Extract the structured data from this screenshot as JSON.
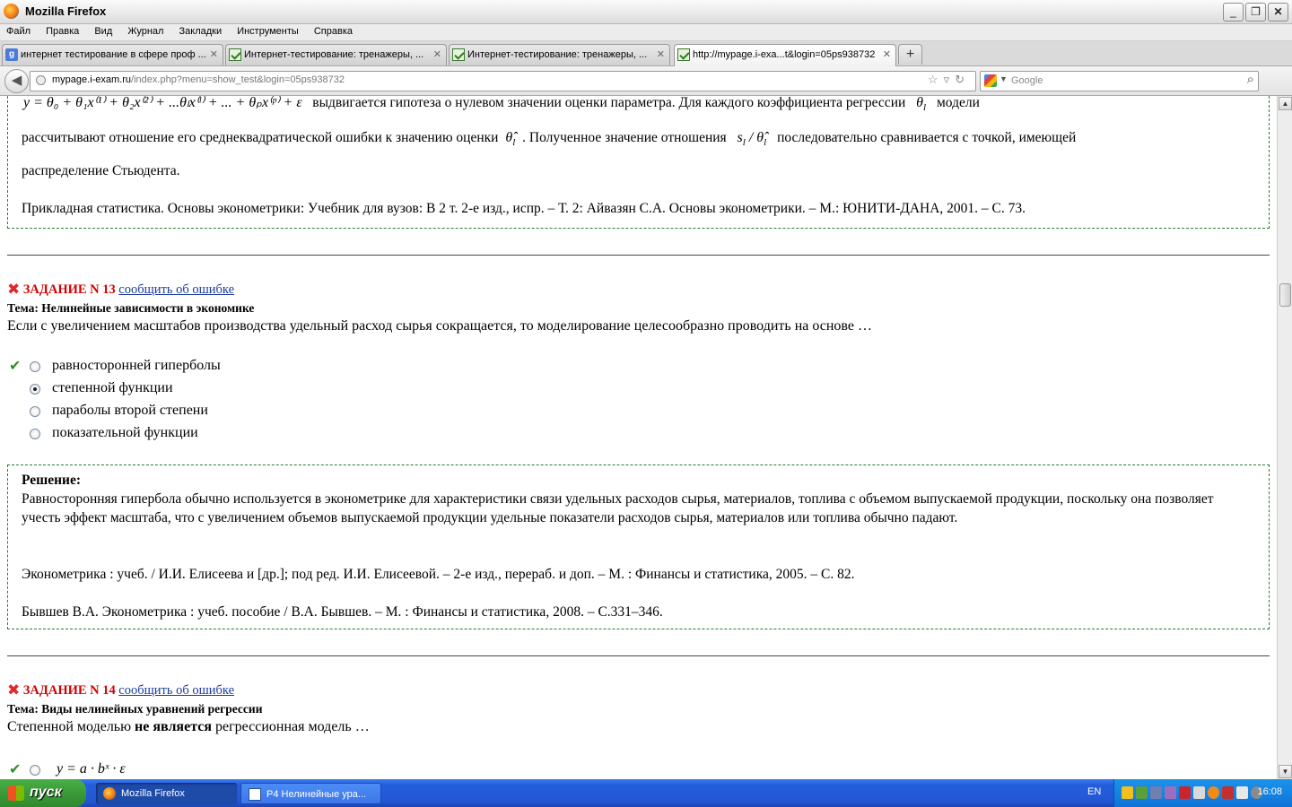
{
  "window": {
    "title": "Mozilla Firefox",
    "buttons": [
      "_",
      "❐",
      "✕"
    ]
  },
  "menu": [
    {
      "label": "Файл"
    },
    {
      "label": "Правка"
    },
    {
      "label": "Вид"
    },
    {
      "label": "Журнал"
    },
    {
      "label": "Закладки"
    },
    {
      "label": "Инструменты"
    },
    {
      "label": "Справка"
    }
  ],
  "tabs": [
    {
      "label": "интернет тестирование в сфере проф ...",
      "icon": "google-icon"
    },
    {
      "label": "Интернет-тестирование: тренажеры, ...",
      "icon": "exam-site-icon"
    },
    {
      "label": "Интернет-тестирование: тренажеры, ...",
      "icon": "exam-site-icon"
    },
    {
      "label": "http://mypage.i-exa...t&login=05ps938732",
      "icon": "exam-site-icon"
    }
  ],
  "newtab": "+",
  "url": {
    "domain": "mypage.i-exam.ru",
    "path": "/index.php?menu=show_test&login=05ps938732"
  },
  "search": {
    "placeholder": "Google"
  },
  "content": {
    "top_formula": "y = θ₀ + θ₁x⁽¹⁾ + θ₂x⁽²⁾ + ...θₗx⁽ˡ⁾ + ... + θₚx⁽ᵖ⁾ + ε",
    "top_p1_a": "выдвигается гипотеза о нулевом значении оценки параметра. Для каждого коэффициента регрессии",
    "top_p1_b": "модели",
    "top_p2_a": "рассчитывают отношение его среднеквадратической ошибки к значению оценки",
    "top_p2_b": ". Полученное значение отношения",
    "top_p2_c": "последовательно сравнивается с точкой, имеющей",
    "top_p3": "распределение Стьюдента.",
    "top_ref": "Прикладная статистика. Основы эконометрики: Учебник для вузов: В 2 т. 2-е изд., испр. – Т. 2: Айвазян С.А. Основы эконометрики. – М.: ЮНИТИ-ДАНА, 2001. – С. 73.",
    "task13": {
      "label": "ЗАДАНИЕ N 13",
      "link": "сообщить об ошибке",
      "topic_prefix": "Тема:",
      "topic": "Нелинейные зависимости в экономике",
      "question": "Если с увеличением масштабов производства удельный расход сырья сокращается, то моделирование целесообразно проводить на основе …",
      "options": [
        {
          "text": "равносторонней гиперболы",
          "correct": true,
          "selected": false
        },
        {
          "text": "степенной функции",
          "correct": false,
          "selected": true
        },
        {
          "text": "параболы второй степени",
          "correct": false,
          "selected": false
        },
        {
          "text": "показательной функции",
          "correct": false,
          "selected": false
        }
      ],
      "solution_title": "Решение:",
      "solution_text": "Равносторонняя гипербола обычно используется в эконометрике для характеристики связи удельных расходов сырья, материалов, топлива с объемом выпускаемой продукции, поскольку она позволяет учесть эффект масштаба, что с увеличением объемов выпускаемой продукции удельные показатели расходов сырья, материалов или топлива обычно падают.",
      "ref1": "Эконометрика : учеб. / И.И. Елисеева и [др.]; под ред. И.И. Елисеевой. – 2-е изд., перераб. и доп. – М. : Финансы и статистика, 2005. – С. 82.",
      "ref2": "Бывшев В.А. Эконометрика : учеб. пособие / В.А. Бывшев. – М. : Финансы и статистика, 2008. – С.331–346."
    },
    "task14": {
      "label": "ЗАДАНИЕ N 14",
      "link": "сообщить об ошибке",
      "topic_prefix": "Тема:",
      "topic": "Виды нелинейных уравнений регрессии",
      "question_a": "Степенной моделью",
      "question_b": "не является",
      "question_c": "регрессионная модель …",
      "option1": "y = a · bˣ · ε"
    }
  },
  "taskbar": {
    "start": "пуск",
    "items": [
      {
        "label": "Mozilla Firefox"
      },
      {
        "label": "P4 Нелинейные ура..."
      }
    ],
    "lang": "EN",
    "clock": "16:08"
  }
}
